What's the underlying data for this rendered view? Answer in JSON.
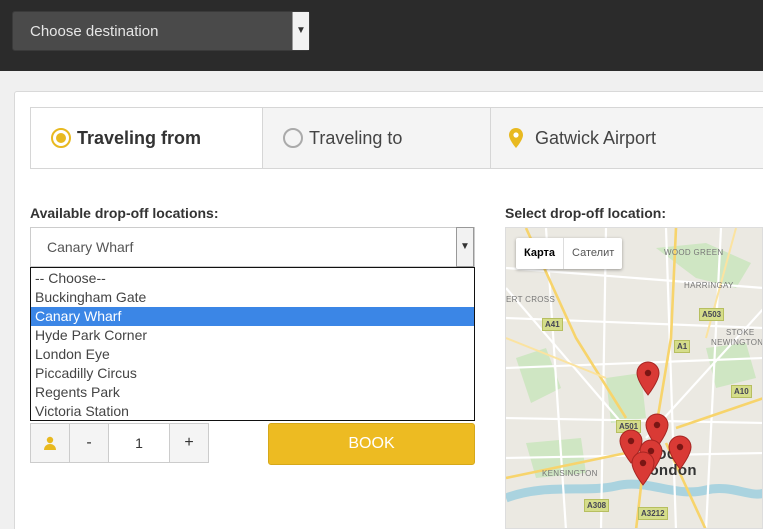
{
  "header": {
    "destination_select": "Choose destination"
  },
  "tabs": {
    "from_label": "Traveling from",
    "to_label": "Traveling to",
    "airport_label": "Gatwick Airport"
  },
  "form": {
    "locations_heading": "Available drop-off locations:",
    "selected_location": "Canary Wharf",
    "options": [
      "-- Choose--",
      "Buckingham Gate",
      "Canary Wharf",
      "Hyde Park Corner",
      "London Eye",
      "Piccadilly Circus",
      "Regents Park",
      "Victoria Station"
    ],
    "selected_index": 2,
    "qty_minus": "-",
    "qty_value": "1",
    "qty_plus": "+",
    "book_label": "BOOK"
  },
  "map": {
    "heading": "Select drop-off location:",
    "map_button": "Карта",
    "satellite_button": "Сателит",
    "places": {
      "wood_green": "WOOD GREEN",
      "harringay": "HARRINGAY",
      "stoke_newington_1": "STOKE",
      "stoke_newington_2": "NEWINGTON",
      "cross": "ERT CROSS",
      "kensington": "KENSINGTON",
      "london_1": "NDON",
      "london_2": "London"
    },
    "roads": {
      "a503": "A503",
      "a41": "A41",
      "a1": "A1",
      "a10": "A10",
      "a501": "A501",
      "a308": "A308",
      "a3212": "A3212"
    }
  },
  "colors": {
    "accent": "#edbb22",
    "selection": "#3b86e6",
    "topbar": "#2b2b2b",
    "marker": "#d93a35"
  }
}
